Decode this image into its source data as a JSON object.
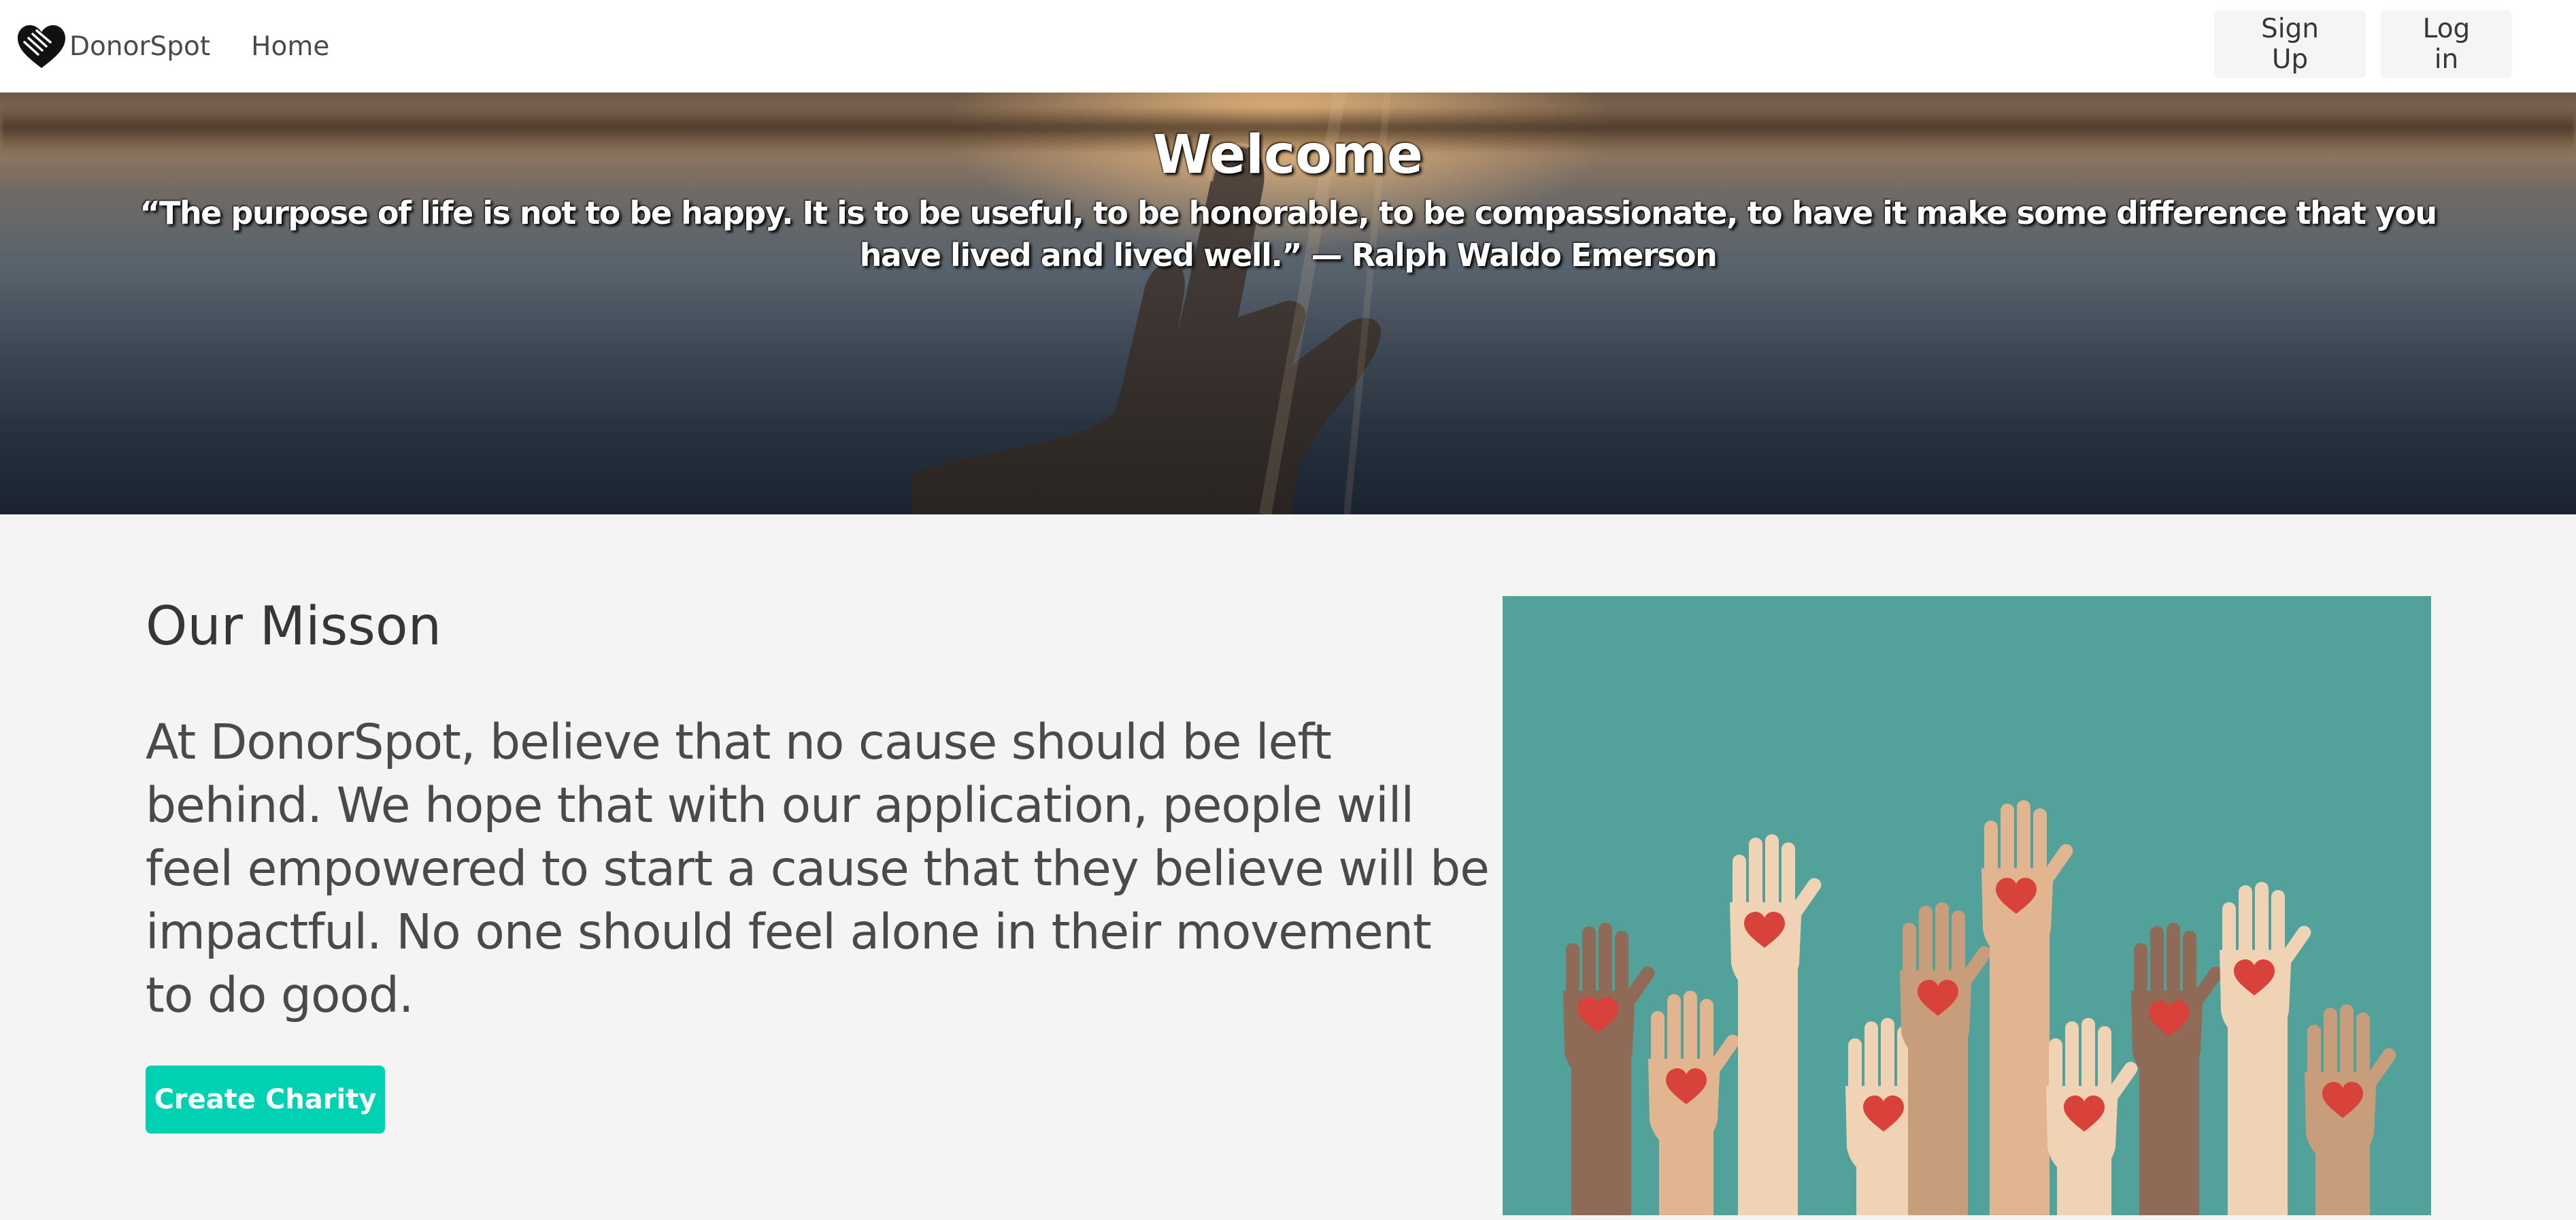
{
  "navbar": {
    "brand_name": "DonorSpot",
    "logo_icon": "heart-handshake-icon",
    "links": {
      "home": "Home"
    },
    "buttons": {
      "signup": "Sign Up",
      "login": "Log in"
    }
  },
  "hero": {
    "title": "Welcome",
    "quote": "“The purpose of life is not to be happy. It is to be useful, to be honorable, to be compassionate, to have it make some difference that you have lived and lived well.” — Ralph Waldo Emerson"
  },
  "mission": {
    "title": "Our Misson",
    "body": "At DonorSpot, believe that no cause should be left behind. We hope that with our application, people will feel empowered to start a cause that they believe will be impactful. No one should feel alone in their movement to do good.",
    "cta_label": "Create Charity"
  },
  "colors": {
    "primary": "#00d1b2",
    "illustration_bg": "#53a19b",
    "heart": "#d9423a",
    "nav_button_bg": "#f5f5f5",
    "section_bg": "#f4f4f4"
  }
}
